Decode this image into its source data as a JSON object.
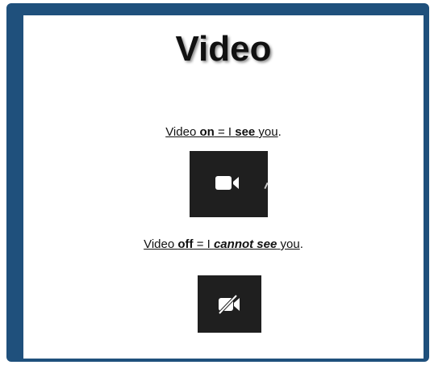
{
  "title": "Video",
  "on_caption": {
    "part1": "Video ",
    "part2": "on",
    "part3": " = I ",
    "part4": "see",
    "part5": " you",
    "end": "."
  },
  "off_caption": {
    "part1": "Video ",
    "part2": "off",
    "part3": " = I ",
    "part4": "cannot see",
    "part5": " you",
    "end": "."
  },
  "icons": {
    "video_on": "video-camera-icon",
    "video_off": "video-camera-off-icon"
  },
  "colors": {
    "frame": "#1f507c",
    "tile": "#1f1f1f",
    "icon": "#ffffff"
  }
}
